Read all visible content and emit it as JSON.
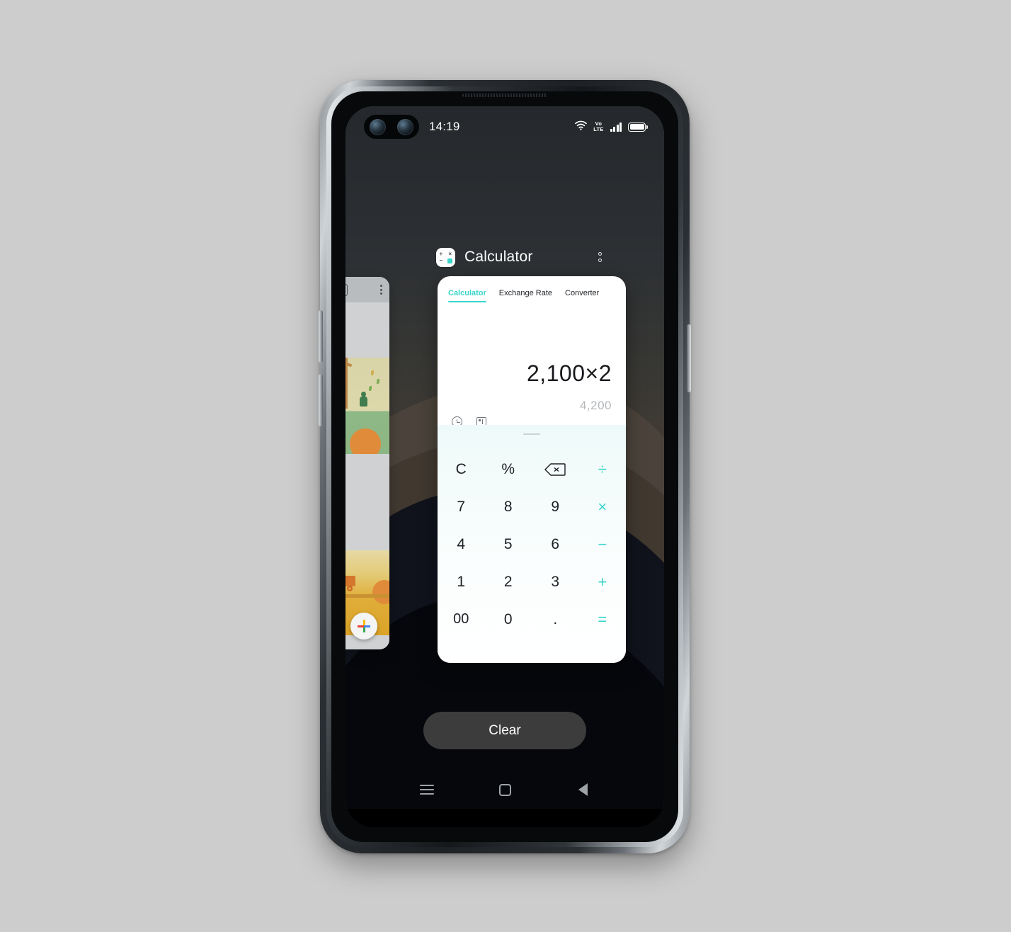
{
  "device": {
    "status_bar": {
      "time": "14:19",
      "volte_label_top": "Vo",
      "volte_label_bottom": "LTE",
      "wifi_icon": "wifi-icon",
      "signal_icon": "cellular-signal-icon",
      "battery_icon": "battery-full-icon",
      "camera_icon": "dual-front-camera-cutout"
    },
    "nav_bar": {
      "recents_label": "recents-icon",
      "home_label": "home-icon",
      "back_label": "back-icon"
    }
  },
  "recents": {
    "clear_button_label": "Clear",
    "background_task": {
      "app_icon": "calendar-icon",
      "menu_icon": "overflow-menu-icon",
      "fab_icon": "add-event-plus-icon"
    },
    "foreground_task": {
      "app_name": "Calculator",
      "app_icon": "calculator-app-icon",
      "menu_icon": "overflow-menu-icon",
      "icon_glyphs": {
        "plus": "+",
        "multiply": "×",
        "minus": "−",
        "equals": "="
      }
    }
  },
  "calculator": {
    "tabs": [
      {
        "label": "Calculator",
        "active": true
      },
      {
        "label": "Exchange Rate",
        "active": false
      },
      {
        "label": "Converter",
        "active": false
      }
    ],
    "display": {
      "expression": "2,100×2",
      "result": "4,200",
      "history_icon": "history-clock-icon",
      "scientific_icon": "scientific-mode-icon"
    },
    "keypad": {
      "handle_icon": "drag-handle",
      "keys": [
        {
          "label": "C",
          "type": "function"
        },
        {
          "label": "%",
          "type": "function"
        },
        {
          "label": "",
          "type": "delete",
          "icon": "backspace-icon"
        },
        {
          "label": "÷",
          "type": "operator"
        },
        {
          "label": "7",
          "type": "digit"
        },
        {
          "label": "8",
          "type": "digit"
        },
        {
          "label": "9",
          "type": "digit"
        },
        {
          "label": "×",
          "type": "operator"
        },
        {
          "label": "4",
          "type": "digit"
        },
        {
          "label": "5",
          "type": "digit"
        },
        {
          "label": "6",
          "type": "digit"
        },
        {
          "label": "−",
          "type": "operator"
        },
        {
          "label": "1",
          "type": "digit"
        },
        {
          "label": "2",
          "type": "digit"
        },
        {
          "label": "3",
          "type": "digit"
        },
        {
          "label": "+",
          "type": "operator"
        },
        {
          "label": "00",
          "type": "digit"
        },
        {
          "label": "0",
          "type": "digit"
        },
        {
          "label": ".",
          "type": "digit"
        },
        {
          "label": "=",
          "type": "operator"
        }
      ]
    }
  },
  "colors": {
    "accent_teal": "#3ad6cb",
    "text_primary": "#1d2024",
    "text_secondary": "#b4b8bc",
    "card_bg": "#ffffff",
    "keypad_bg": "#eefaf9",
    "clear_button_bg": "#3c3c3c",
    "page_bg": "#cdcdcd"
  }
}
